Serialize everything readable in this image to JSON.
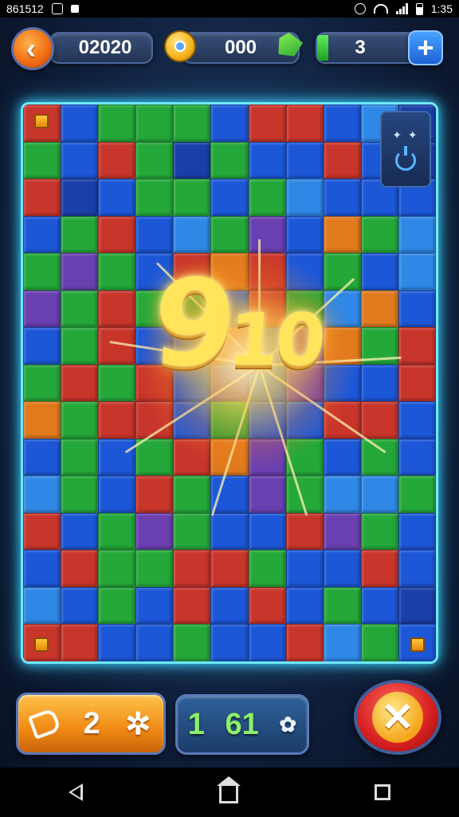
{
  "status_bar": {
    "left_text": "861512",
    "time": "1:35"
  },
  "hud": {
    "score": "02020",
    "coins": "000",
    "lives": "3",
    "plus_label": "+"
  },
  "board": {
    "big_number_main": "9",
    "big_number_small": "10",
    "hint_dots": "✦ ✦"
  },
  "actions": {
    "orange_count": "2",
    "blue_left": "1",
    "blue_right": "61",
    "close_symbol": "✕"
  },
  "colors": {
    "board_glow": "#6fe8ff",
    "accent_orange": "#f08a14",
    "accent_red": "#d61f1f",
    "accent_blue": "#1c63d6"
  },
  "icons": [
    "back-chevron-icon",
    "coin-icon",
    "gem-icon",
    "life-bar-icon",
    "plus-icon",
    "hint-icon",
    "tag-icon",
    "gear-icon",
    "close-icon",
    "nav-back-icon",
    "nav-home-icon",
    "nav-recent-icon"
  ]
}
